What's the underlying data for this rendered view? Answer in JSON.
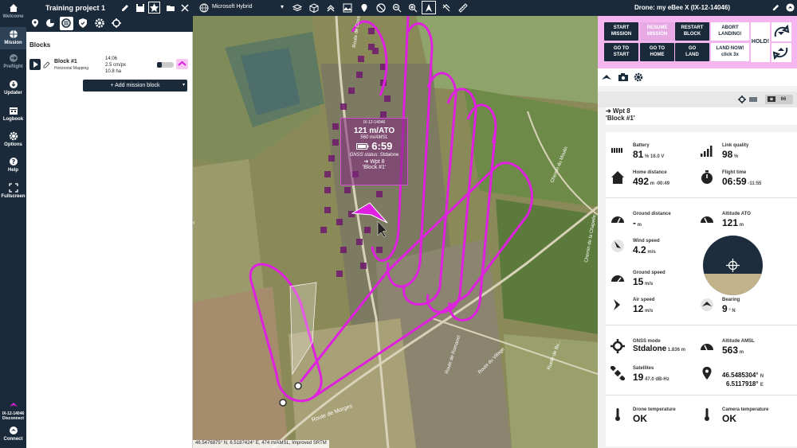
{
  "rail": {
    "items": [
      {
        "label": "Welcome",
        "icon": "home-icon"
      },
      {
        "label": "Mission",
        "icon": "globe-icon"
      },
      {
        "label": "Preflight",
        "icon": "arrow-circle-icon"
      },
      {
        "label": "Updater",
        "icon": "download-icon"
      },
      {
        "label": "Logbook",
        "icon": "calendar-icon"
      },
      {
        "label": "Options",
        "icon": "gear-icon"
      },
      {
        "label": "Help",
        "icon": "help-icon"
      },
      {
        "label": "Fullscreen",
        "icon": "fullscreen-icon"
      }
    ],
    "drone_id": "IX-12-14046",
    "disconnect": "Disconnect",
    "connect": "Connect"
  },
  "project": {
    "title": "Training project 1",
    "blocks_heading": "Blocks",
    "block": {
      "name": "Block #1",
      "type": "Horizontal Mapping",
      "time": "14:06",
      "gsd": "2.5 cm/px",
      "area": "10.8 ha"
    },
    "add_block": "Add mission block"
  },
  "map": {
    "layer": "Microsoft Hybrid",
    "status": "46.5476875° N, 6.5187424° E, 474 m/AMSL, Improved SRTM",
    "tooltip": {
      "id": "IX-12-14046",
      "alt_ato": "121 m/ATO",
      "alt_amsl": "560 m/AMSL",
      "time": "6:59",
      "gnss": "GNSS status: Stdalone",
      "wpt": "➔ Wpt 8",
      "block": "'Block #1'"
    },
    "labels": [
      "Route de Cossonay",
      "Route de Morges",
      "Route de Romanel",
      "Route du Village",
      "Ruelle de Bu...",
      "Chemin du Moulin",
      "Chemin de la Chapelle"
    ],
    "colors": {
      "track": "#e020e0",
      "photo": "#6e1a6e"
    }
  },
  "drone": {
    "title": "Drone: my eBee X (IX-12-14046)",
    "commands": {
      "start_mission": [
        "START",
        "MISSION"
      ],
      "resume_mission": [
        "RESUME",
        "MISSION"
      ],
      "restart_block": [
        "RESTART",
        "BLOCK"
      ],
      "abort_landing": [
        "ABORT",
        "LANDING!"
      ],
      "go_to_start": [
        "GO TO",
        "START"
      ],
      "go_to_home": [
        "GO TO",
        "HOME"
      ],
      "go_land": [
        "GO",
        "LAND"
      ],
      "land_now": [
        "LAND NOW!",
        "click 3x"
      ],
      "hold": "HOLD!"
    },
    "photo_count": "66",
    "waypoint": "➔ Wpt 8",
    "waypoint_block": "'Block #1'",
    "telemetry": {
      "battery": {
        "label": "Battery",
        "value": "81",
        "unit": "%",
        "sub": "16.0 V"
      },
      "link": {
        "label": "Link quality",
        "value": "98",
        "unit": "%"
      },
      "home_distance": {
        "label": "Home distance",
        "value": "492",
        "unit": "m",
        "sub": "-00:49"
      },
      "flight_time": {
        "label": "Flight time",
        "value": "06:59",
        "sub": "-11:55"
      },
      "ground_distance": {
        "label": "Ground distance",
        "value": "-",
        "unit": "m"
      },
      "altitude_ato": {
        "label": "Altitude ATO",
        "value": "121",
        "unit": "m"
      },
      "wind_speed": {
        "label": "Wind speed",
        "value": "4.2",
        "unit": "m/s"
      },
      "ground_speed": {
        "label": "Ground speed",
        "value": "15",
        "unit": "m/s"
      },
      "air_speed": {
        "label": "Air speed",
        "value": "12",
        "unit": "m/s"
      },
      "bearing": {
        "label": "Bearing",
        "value": "9",
        "unit": "° N"
      },
      "gnss_mode": {
        "label": "GNSS mode",
        "value": "Stdalone",
        "sub": "1.836 m"
      },
      "altitude_amsl": {
        "label": "Altitude AMSL",
        "value": "563",
        "unit": "m"
      },
      "satellites": {
        "label": "Satellites",
        "value": "19",
        "sub": "47.0 dB-Hz"
      },
      "position": {
        "label": "",
        "lat": "46.5485304°",
        "lat_dir": "N",
        "lon": "6.5117918°",
        "lon_dir": "E"
      },
      "drone_temp": {
        "label": "Drone temperature",
        "value": "OK"
      },
      "camera_temp": {
        "label": "Camera temperature",
        "value": "OK"
      }
    }
  }
}
